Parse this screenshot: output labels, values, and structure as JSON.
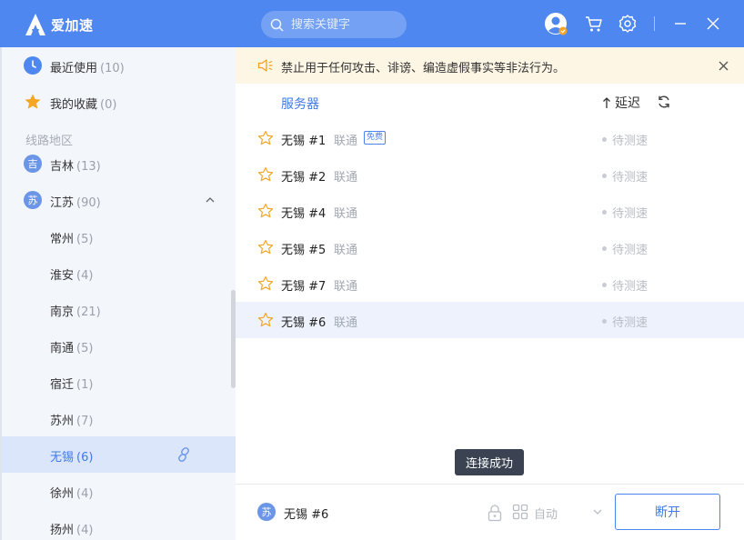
{
  "app": {
    "name": "爱加速"
  },
  "search": {
    "placeholder": "搜索关键字"
  },
  "sidebar": {
    "recent": {
      "label": "最近使用",
      "count": "(10)"
    },
    "favorites": {
      "label": "我的收藏",
      "count": "(0)"
    },
    "section_title": "线路地区",
    "provinces": [
      {
        "badge": "吉",
        "label": "吉林",
        "count": "(13)"
      },
      {
        "badge": "苏",
        "label": "江苏",
        "count": "(90)"
      }
    ],
    "cities": [
      {
        "label": "常州",
        "count": "(5)"
      },
      {
        "label": "淮安",
        "count": "(4)"
      },
      {
        "label": "南京",
        "count": "(21)"
      },
      {
        "label": "南通",
        "count": "(5)"
      },
      {
        "label": "宿迁",
        "count": "(1)"
      },
      {
        "label": "苏州",
        "count": "(7)"
      },
      {
        "label": "无锡",
        "count": "(6)"
      },
      {
        "label": "徐州",
        "count": "(4)"
      },
      {
        "label": "扬州",
        "count": "(4)"
      }
    ]
  },
  "notice": {
    "text": "禁止用于任何攻击、诽谤、编造虚假事实等非法行为。"
  },
  "list": {
    "col_server": "服务器",
    "col_latency": "延迟",
    "free_tag": "免费",
    "rows": [
      {
        "name": "无锡 #1",
        "isp": "联通",
        "status": "待测速"
      },
      {
        "name": "无锡 #2",
        "isp": "联通",
        "status": "待测速"
      },
      {
        "name": "无锡 #4",
        "isp": "联通",
        "status": "待测速"
      },
      {
        "name": "无锡 #5",
        "isp": "联通",
        "status": "待测速"
      },
      {
        "name": "无锡 #7",
        "isp": "联通",
        "status": "待测速"
      },
      {
        "name": "无锡 #6",
        "isp": "联通",
        "status": "待测速"
      }
    ]
  },
  "tooltip": "连接成功",
  "bottom": {
    "badge": "苏",
    "server": "无锡 #6",
    "mode": "自动",
    "disconnect": "断开"
  },
  "colors": {
    "brand": "#4e87f0",
    "accent": "#3f7ae6",
    "selected_row": "#edf2fc",
    "notice_bg": "#fdf6e4",
    "star": "#f5a623"
  },
  "icons": [
    "logo-icon",
    "search-icon",
    "avatar-icon",
    "cart-icon",
    "settings-icon",
    "minimize-icon",
    "close-icon",
    "clock-icon",
    "star-icon",
    "chevron-up-icon",
    "link-icon",
    "speaker-icon",
    "sort-arrow-icon",
    "refresh-icon",
    "lock-icon",
    "grid-icon",
    "chevron-down-icon"
  ]
}
